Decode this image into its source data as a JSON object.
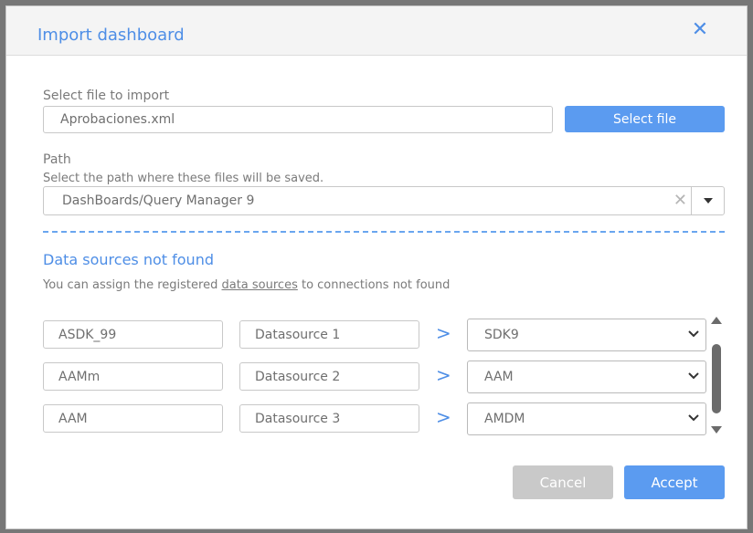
{
  "dialog": {
    "title": "Import dashboard",
    "close_icon": "close-icon"
  },
  "file": {
    "label": "Select file to import",
    "value": "Aprobaciones.xml",
    "button_label": "Select file"
  },
  "path": {
    "label": "Path",
    "description": "Select the path where these files will be saved.",
    "value": "DashBoards/Query Manager 9"
  },
  "datasources": {
    "title": "Data sources not found",
    "desc_prefix": "You can assign the registered ",
    "desc_link": "data sources",
    "desc_suffix": " to connections not found",
    "rows": [
      {
        "connection": "ASDK_99",
        "placeholder": "Datasource 1",
        "selected": "SDK9"
      },
      {
        "connection": "AAMm",
        "placeholder": "Datasource 2",
        "selected": "AAM"
      },
      {
        "connection": "AAM",
        "placeholder": "Datasource 3",
        "selected": "AMDM"
      }
    ]
  },
  "footer": {
    "cancel_label": "Cancel",
    "accept_label": "Accept"
  },
  "colors": {
    "accent": "#4e8ee6",
    "primary_button": "#5b9bf0",
    "disabled_button": "#c9c9c9"
  }
}
